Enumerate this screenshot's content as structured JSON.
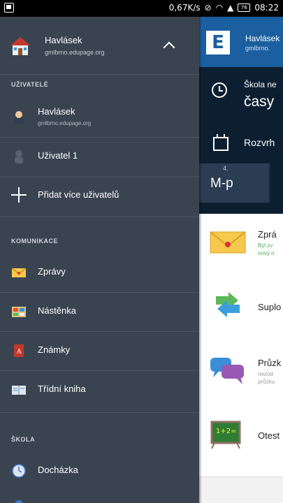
{
  "status_bar": {
    "speed": "0,67K/s",
    "battery": "76",
    "time": "08:22"
  },
  "drawer": {
    "account": {
      "name": "Havlásek",
      "url": "gmlbrno.edupage.org"
    },
    "users_header": "UŽIVATELÉ",
    "users": [
      {
        "name": "Havlásek",
        "url": "gmlbrno.edupage.org"
      },
      {
        "name": "Uživatel 1"
      }
    ],
    "add_users_label": "Přidat více uživatelů",
    "communication_header": "KOMUNIKACE",
    "communication_items": [
      "Zprávy",
      "Nástěnka",
      "Známky",
      "Třídní kniha"
    ],
    "school_header": "ŠKOLA",
    "school_items": [
      "Docházka"
    ]
  },
  "background_app": {
    "title": "Havlásek",
    "subtitle": "gmlbrno.",
    "logo_letter": "E",
    "schedule_line1": "Škola ne",
    "schedule_line2": "časy",
    "timetable_label": "Rozvrh",
    "lesson_number": "4.",
    "lesson_subject": "M-p",
    "cards": [
      {
        "title": "Zprá",
        "sub1": "Byl zv",
        "sub2": "nový n"
      },
      {
        "title": "Suplo"
      },
      {
        "title": "Průzk",
        "sub1": "nezod",
        "sub2": "průzku"
      },
      {
        "title": "Otest"
      }
    ]
  },
  "colors": {
    "drawer_bg": "#3a4450",
    "header_blue": "#1b5fa0",
    "dark_panel": "#0c1f31"
  }
}
